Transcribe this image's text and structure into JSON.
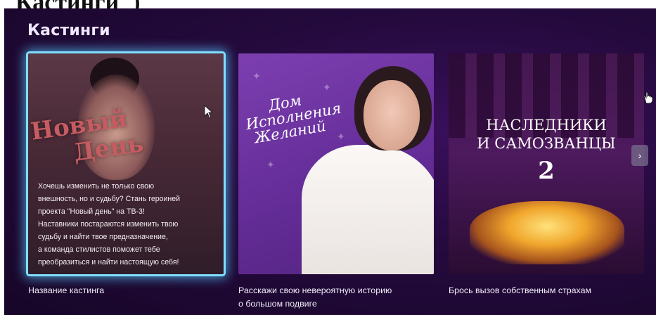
{
  "document": {
    "heading_fragment": "Кастинги\")"
  },
  "section": {
    "title": "Кастинги"
  },
  "cards": [
    {
      "logo_line1": "Новый",
      "logo_line2": "День",
      "description_lines": [
        "Хочешь изменить не только свою",
        "внешность, но и судьбу? Стань героиней",
        "проекта \"Новый день\" на ТВ-3!",
        "Наставники постараются изменить твою",
        "судьбу и найти твое предназначение,",
        "а команда стилистов поможет тебе",
        "преобразиться и найти настоящую себя!"
      ],
      "caption": "Название кастинга"
    },
    {
      "logo_lines": [
        "Дом",
        "Исполнения",
        "Желаний"
      ],
      "caption_lines": [
        "Расскажи свою невероятную историю",
        "о большом подвиге"
      ]
    },
    {
      "title_line1": "НАСЛЕДНИКИ",
      "title_line2": "И САМОЗВАНЦЫ",
      "season": "2",
      "caption": "Брось вызов собственным страхам"
    }
  ],
  "controls": {
    "next_icon": "chevron-right-icon",
    "next_glyph": "›"
  },
  "colors": {
    "background": "#240a3d",
    "highlight_glow": "#58cdff",
    "text": "#f3ecfa"
  }
}
